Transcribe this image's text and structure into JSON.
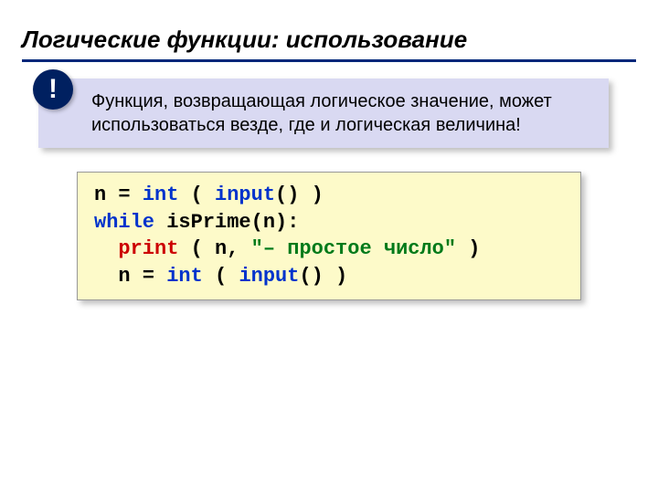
{
  "title": "Логические функции: использование",
  "bang": "!",
  "info_text": "Функция, возвращающая логическое значение, может использоваться везде, где и логическая величина!",
  "code": {
    "l1_a": "n = ",
    "l1_int": "int",
    "l1_b": " ( ",
    "l1_inp": "input",
    "l1_c": "() )",
    "l2_while": "while",
    "l2_a": " isPrime(n):",
    "l3_sp": "  ",
    "l3_print": "print",
    "l3_a": " ( n, ",
    "l3_str": "\"– простое число\"",
    "l3_b": " )  ",
    "l4_sp": "  ",
    "l4_a": "n = ",
    "l4_int": "int",
    "l4_b": " ( ",
    "l4_inp": "input",
    "l4_c": "() )"
  }
}
